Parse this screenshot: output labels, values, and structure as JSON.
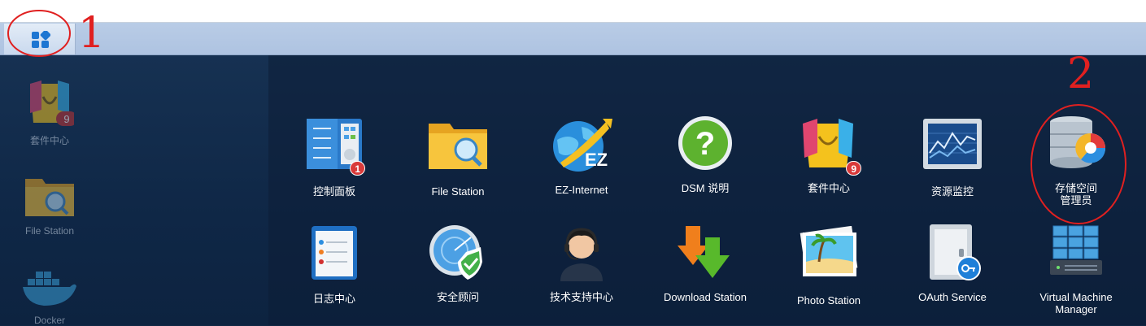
{
  "taskbar": {
    "main_menu_icon": "grid-apps-icon"
  },
  "desktop_shortcuts": [
    {
      "label": "套件中心",
      "icon": "package-center-icon",
      "badge": "9"
    },
    {
      "label": "File Station",
      "icon": "file-station-folder-icon"
    },
    {
      "label": "Docker",
      "icon": "docker-whale-icon"
    }
  ],
  "main_menu": {
    "apps": [
      {
        "label": "控制面板",
        "icon": "control-panel-icon",
        "badge": "1"
      },
      {
        "label": "File Station",
        "icon": "file-station-folder-icon"
      },
      {
        "label": "EZ-Internet",
        "icon": "ez-internet-globe-icon"
      },
      {
        "label": "DSM 说明",
        "icon": "help-question-icon"
      },
      {
        "label": "套件中心",
        "icon": "package-center-icon",
        "badge": "9"
      },
      {
        "label": "资源监控",
        "icon": "resource-monitor-icon"
      },
      {
        "label": "存储空间管理员",
        "label_line1": "存储空间",
        "label_line2": "管理员",
        "icon": "storage-manager-icon"
      },
      {
        "label": "日志中心",
        "icon": "log-center-icon"
      },
      {
        "label": "安全顾问",
        "icon": "security-advisor-icon"
      },
      {
        "label": "技术支持中心",
        "icon": "support-center-headset-icon"
      },
      {
        "label": "Download Station",
        "icon": "download-station-icon"
      },
      {
        "label": "Photo Station",
        "icon": "photo-station-icon"
      },
      {
        "label": "OAuth Service",
        "icon": "oauth-service-icon"
      },
      {
        "label": "Virtual Machine Manager",
        "label_line1": "Virtual Machine",
        "label_line2": "Manager",
        "icon": "virtual-machine-manager-icon"
      }
    ]
  },
  "annotations": {
    "label_1": "1",
    "label_2": "2",
    "color": "#e02020"
  },
  "colors": {
    "badge": "#d93a3a",
    "taskbar": "#b3c7e3",
    "desktop": "#0f2744"
  }
}
